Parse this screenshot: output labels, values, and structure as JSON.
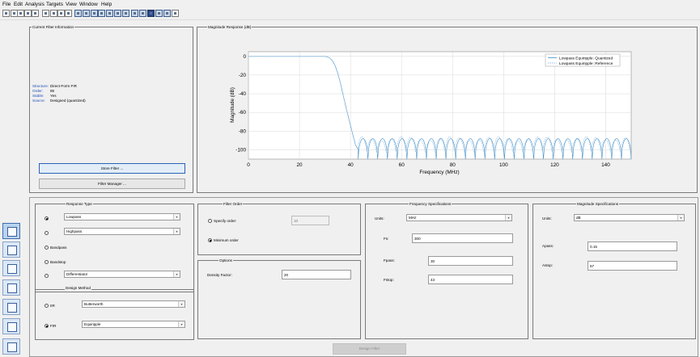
{
  "menu": [
    "File",
    "Edit",
    "Analysis",
    "Targets",
    "View",
    "Window",
    "Help"
  ],
  "icons": {
    "toolbar": [
      "new-icon",
      "open-icon",
      "save-icon",
      "print-icon",
      "print-preview-icon",
      "zoom-in-icon",
      "zoom-x-icon",
      "zoom-y-icon",
      "full-view-icon",
      "magnitude-icon",
      "phase-icon",
      "mag-phase-icon",
      "group-delay-icon",
      "phase-delay-icon",
      "impulse-icon",
      "step-icon",
      "pole-zero-icon",
      "coefficients-icon",
      "info-icon",
      "cost-icon",
      "legend-icon",
      "whats-this-icon"
    ],
    "sidebar": [
      "design-filter-icon",
      "transform-icon",
      "import-icon",
      "realize-icon",
      "multirate-icon",
      "quantize-icon",
      "pole-zero-editor-icon"
    ]
  },
  "filter_info": {
    "title": "Current Filter Information",
    "rows": [
      {
        "k": "Structure:",
        "v": "Direct-Form FIR"
      },
      {
        "k": "Order:",
        "v": "85"
      },
      {
        "k": "Stable:",
        "v": "Yes"
      },
      {
        "k": "Source:",
        "v": "Designed (quantized)"
      }
    ],
    "store_button": "Store Filter ...",
    "manager_button": "Filter Manager ..."
  },
  "response_type": {
    "title": "Response Type",
    "lowpass": "Lowpass",
    "highpass": "Highpass",
    "bandpass": "Bandpass",
    "bandstop": "Bandstop",
    "differentiator": "Differentiator"
  },
  "design_method": {
    "title": "Design Method",
    "iir": "IIR",
    "iir_type": "Butterworth",
    "fir": "FIR",
    "fir_type": "Equiripple"
  },
  "filter_order": {
    "title": "Filter Order",
    "specify": "Specify order:",
    "specify_value": "10",
    "minimum": "Minimum order"
  },
  "options": {
    "title": "Options",
    "density_label": "Density Factor:",
    "density_value": "20"
  },
  "freq_specs": {
    "title": "Frequency Specifications",
    "units_label": "Units:",
    "units": "MHz",
    "fs_label": "Fs:",
    "fs": "300",
    "fpass_label": "Fpass:",
    "fpass": "30",
    "fstop_label": "Fstop:",
    "fstop": "43"
  },
  "mag_specs": {
    "title": "Magnitude Specifications",
    "units_label": "Units:",
    "units": "dB",
    "apass_label": "Apass:",
    "apass": "0.15",
    "astop_label": "Astop:",
    "astop": "57"
  },
  "design_button": "Design Filter",
  "colors": {
    "quantized": "#3f8fc9",
    "reference": "#7fb0d8"
  },
  "chart_data": {
    "type": "line",
    "title": "Magnitude Response (dB)",
    "xlabel": "Frequency (MHz)",
    "ylabel": "Magnitude (dB)",
    "xlim": [
      0,
      150
    ],
    "ylim": [
      -110,
      5
    ],
    "xticks": [
      0,
      20,
      40,
      60,
      80,
      100,
      120,
      140
    ],
    "yticks": [
      0,
      -20,
      -40,
      -60,
      -80,
      -100
    ],
    "grid": true,
    "legend": "top-right",
    "series": [
      {
        "name": "Lowpass Equiripple: Quantized",
        "style": "solid",
        "x": [
          0,
          30,
          31,
          32,
          33,
          34,
          35,
          36,
          37,
          38,
          39,
          40,
          41,
          42,
          43,
          150
        ],
        "y": [
          0,
          0,
          -0.5,
          -2,
          -5,
          -10,
          -18,
          -28,
          -40,
          -52,
          -63,
          -74,
          -85,
          -95,
          -100,
          -100
        ]
      },
      {
        "name": "Lowpass Equiripple: Reference",
        "style": "dashed",
        "x": [
          0,
          30,
          31,
          32,
          33,
          34,
          35,
          36,
          37,
          38,
          39,
          40,
          41,
          42,
          43,
          150
        ],
        "y": [
          0,
          0,
          -0.5,
          -2,
          -5,
          -10,
          -18,
          -28,
          -40,
          -52,
          -63,
          -74,
          -85,
          -95,
          -100,
          -100
        ]
      }
    ],
    "stopband_ripple": {
      "start": 43,
      "end": 150,
      "lobes": 28,
      "top": -88,
      "floor": -110
    }
  }
}
